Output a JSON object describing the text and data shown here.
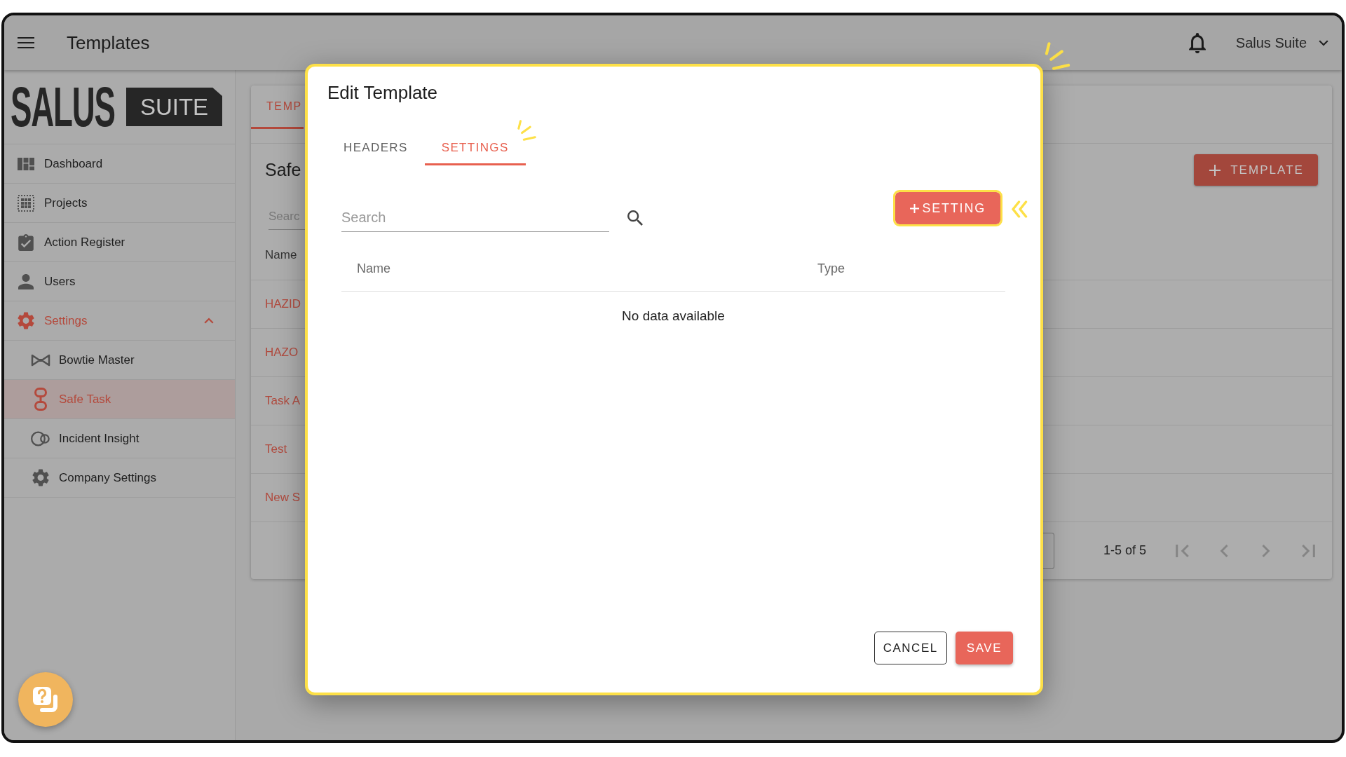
{
  "app_bar": {
    "title": "Templates",
    "account": "Salus Suite"
  },
  "sidebar": {
    "logo": {
      "wordmark": "SALUS",
      "badge": "SUITE"
    },
    "items": [
      {
        "label": "Dashboard",
        "selected": false
      },
      {
        "label": "Projects",
        "selected": false
      },
      {
        "label": "Action Register",
        "selected": false
      },
      {
        "label": "Users",
        "selected": false
      },
      {
        "label": "Settings",
        "selected": false,
        "expanded": true,
        "children": [
          {
            "label": "Bowtie Master",
            "selected": false
          },
          {
            "label": "Safe Task",
            "selected": true
          },
          {
            "label": "Incident Insight",
            "selected": false
          },
          {
            "label": "Company Settings",
            "selected": false
          }
        ]
      }
    ]
  },
  "page": {
    "tabs": [
      {
        "label": "TEMP",
        "selected": true
      }
    ],
    "title": "Safe",
    "add_button": {
      "label": "TEMPLATE"
    },
    "search": {
      "placeholder": "Searc"
    },
    "table": {
      "columns": [
        "Name"
      ],
      "rows": [
        [
          "HAZID"
        ],
        [
          "HAZO"
        ],
        [
          "Task A"
        ],
        [
          "Test"
        ],
        [
          "New S"
        ]
      ]
    },
    "pagination": {
      "range": "1-5 of 5",
      "buttons": [
        {
          "kind": "first",
          "disabled": true
        },
        {
          "kind": "previous",
          "disabled": true
        },
        {
          "kind": "next",
          "disabled": true
        },
        {
          "kind": "last",
          "disabled": true
        }
      ]
    }
  },
  "dialog": {
    "highlighted": true,
    "title": "Edit Template",
    "tabs": [
      {
        "label": "HEADERS",
        "selected": false,
        "highlighted": false
      },
      {
        "label": "SETTINGS",
        "selected": true,
        "highlighted": true
      }
    ],
    "search": {
      "placeholder": "Search"
    },
    "add_button": {
      "label": "SETTING",
      "highlighted": true
    },
    "table": {
      "columns": [
        "Name",
        "Type"
      ],
      "empty_text": "No data available"
    },
    "actions": [
      {
        "label": "CANCEL",
        "kind": "outlined"
      },
      {
        "label": "SAVE",
        "kind": "primary"
      }
    ]
  }
}
